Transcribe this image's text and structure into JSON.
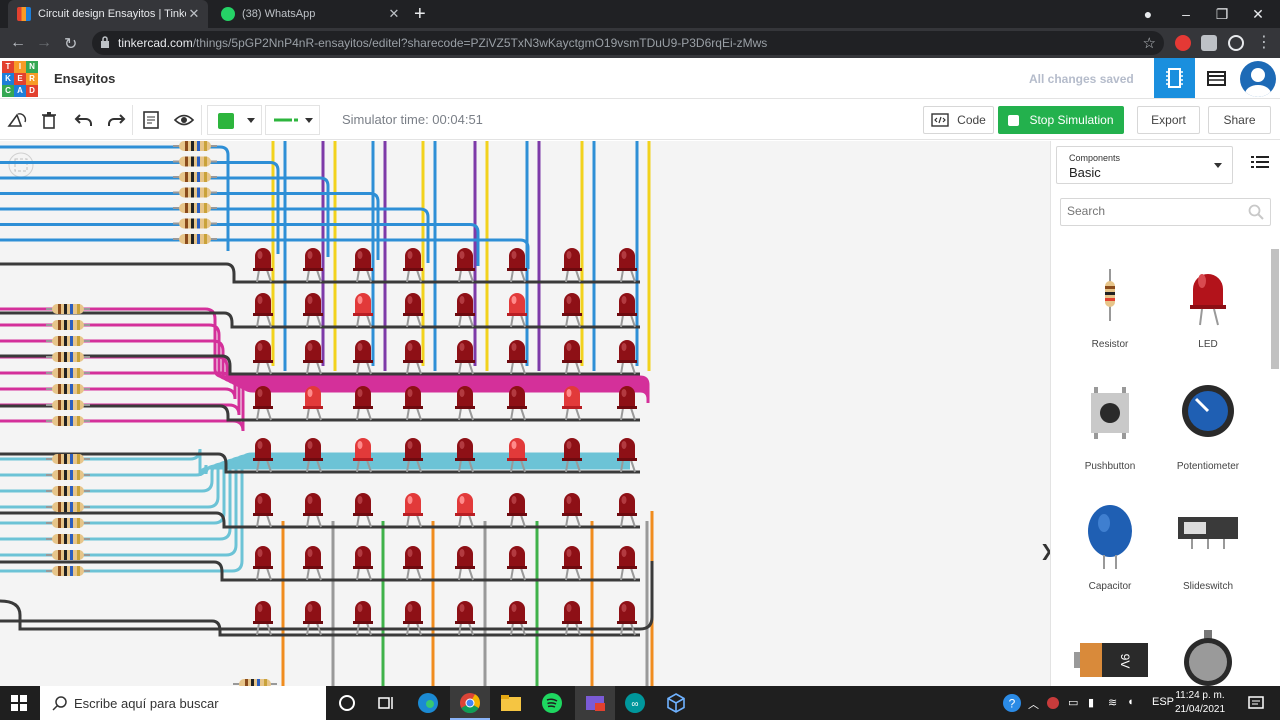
{
  "browser": {
    "tabs": [
      {
        "title": "Circuit design Ensayitos | Tinkerc",
        "active": true
      },
      {
        "title": "(38) WhatsApp",
        "active": false
      }
    ],
    "url_host": "tinkercad.com",
    "url_rest": "/things/5pGP2NnP4nR-ensayitos/editel?sharecode=PZiVZ5TxN3wKayctgmO19vsmTDuU9-P3D6rqEi-zMws",
    "window_controls": [
      "minimize-icon",
      "maximize-icon",
      "close-icon"
    ]
  },
  "app": {
    "logo_letters": [
      "T",
      "I",
      "N",
      "K",
      "E",
      "R",
      "C",
      "A",
      "D"
    ],
    "logo_colors": [
      "#e2412f",
      "#f89b26",
      "#35a853",
      "#1d7ed8",
      "#e2412f",
      "#f89b26",
      "#35a853",
      "#1d7ed8",
      "#e2412f"
    ],
    "project_name": "Ensayitos",
    "save_status": "All changes saved",
    "accent": "#1a8fde"
  },
  "toolbar": {
    "sim_time": "Simulator time: 00:04:51",
    "code_label": "Code",
    "stop_label": "Stop Simulation",
    "export_label": "Export",
    "share_label": "Share",
    "selected_color": "#2db53d",
    "tools": [
      "rotate-icon",
      "delete-icon",
      "undo-icon",
      "redo-icon",
      "notes-icon",
      "visibility-icon"
    ]
  },
  "sidebar": {
    "components_label": "Components",
    "components_value": "Basic",
    "search_placeholder": "Search",
    "items": [
      {
        "name": "Resistor",
        "icon": "resistor-icon"
      },
      {
        "name": "LED",
        "icon": "led-icon"
      },
      {
        "name": "Pushbutton",
        "icon": "pushbutton-icon"
      },
      {
        "name": "Potentiometer",
        "icon": "potentiometer-icon"
      },
      {
        "name": "Capacitor",
        "icon": "capacitor-icon"
      },
      {
        "name": "Slideswitch",
        "icon": "slideswitch-icon"
      },
      {
        "name": "9V battery",
        "icon": "battery-9v-icon",
        "label_text": "9V"
      },
      {
        "name": "Coin cell battery",
        "icon": "coin-cell-battery-icon"
      }
    ]
  },
  "circuit": {
    "led_rows": 8,
    "led_cols": 8,
    "lit_leds": [
      [
        1,
        2
      ],
      [
        1,
        5
      ],
      [
        3,
        1
      ],
      [
        3,
        6
      ],
      [
        4,
        2
      ],
      [
        4,
        5
      ],
      [
        5,
        3
      ],
      [
        5,
        4
      ]
    ],
    "resistor_groups": 4
  },
  "taskbar": {
    "search_placeholder": "Escribe aquí para buscar",
    "language": "ESP",
    "time": "11:24 p. m.",
    "date": "21/04/2021"
  }
}
